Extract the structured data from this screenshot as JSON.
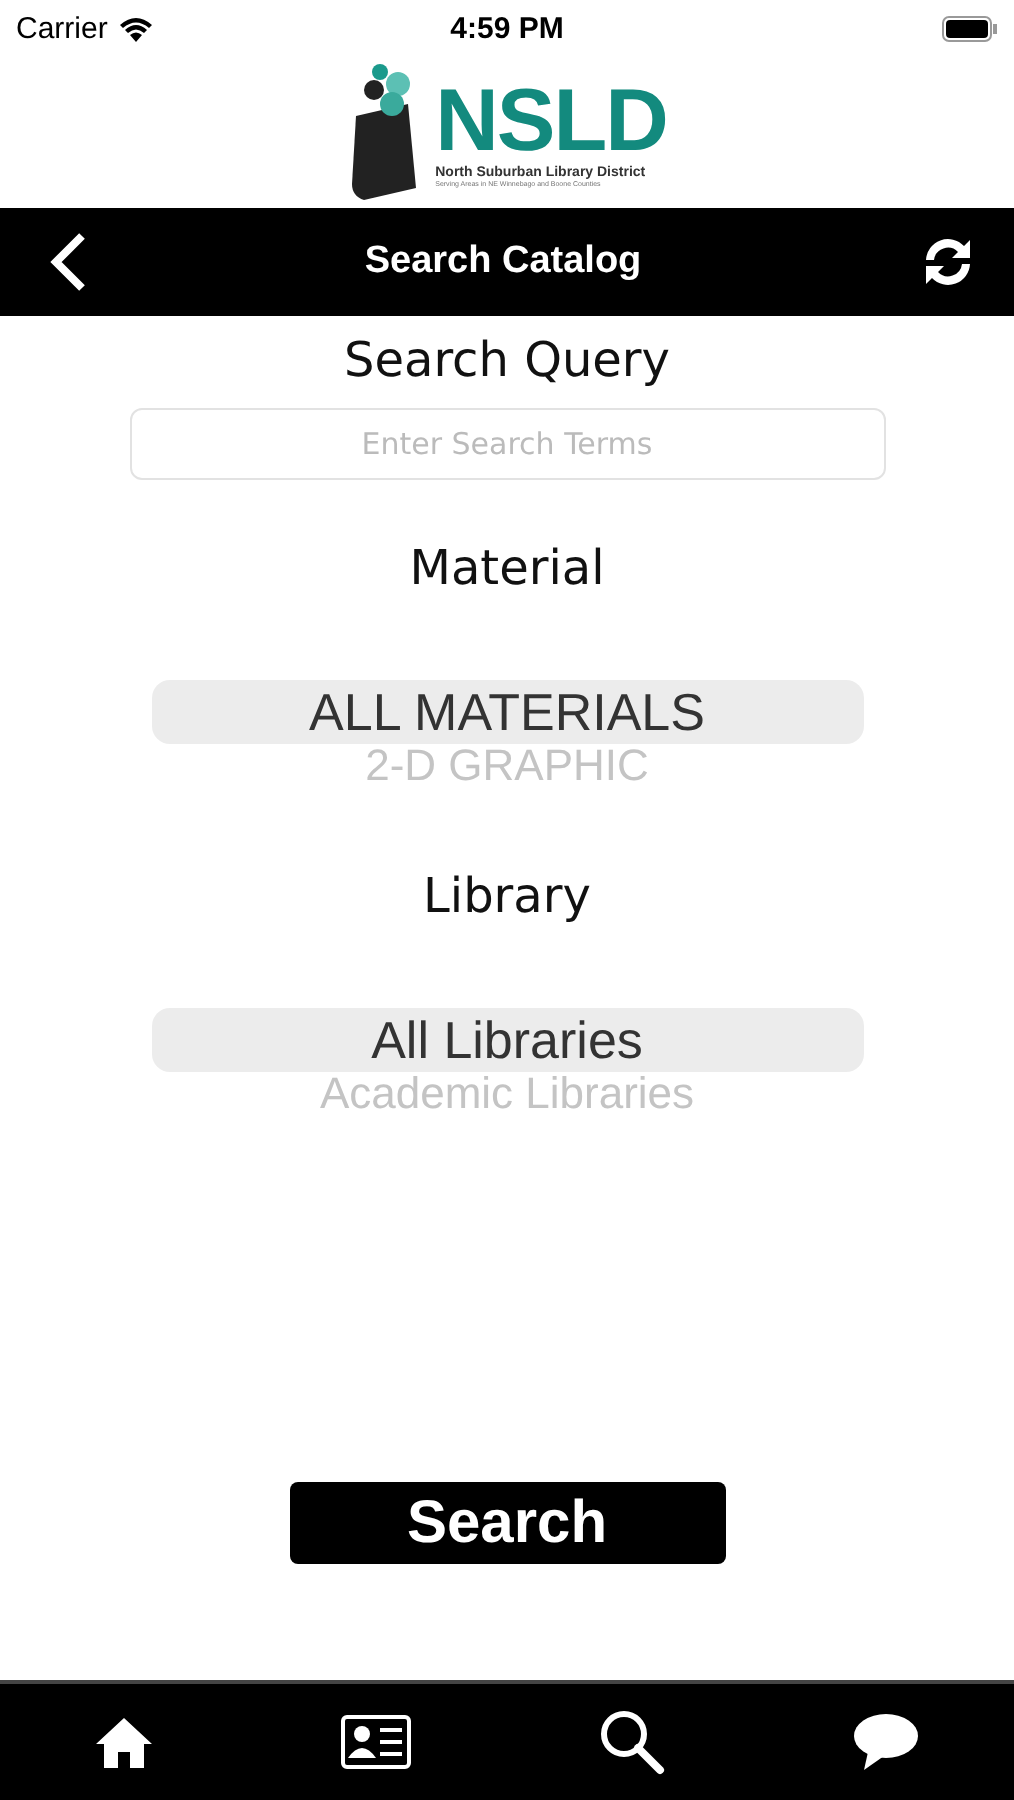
{
  "status_bar": {
    "carrier": "Carrier",
    "time": "4:59 PM"
  },
  "logo": {
    "wordmark": "NSLD",
    "name": "North Suburban Library District",
    "tagline": "Serving Areas in NE Winnebago and Boone Counties"
  },
  "nav_bar": {
    "title": "Search Catalog"
  },
  "search": {
    "label": "Search Query",
    "placeholder": "Enter Search Terms"
  },
  "pickers": [
    {
      "label": "Material",
      "options": [
        {
          "text": "ALL MATERIALS",
          "selected": true
        },
        {
          "text": "2-D GRAPHIC",
          "selected": false
        }
      ]
    },
    {
      "label": "Library",
      "options": [
        {
          "text": "All Libraries",
          "selected": true
        },
        {
          "text": "Academic Libraries",
          "selected": false
        }
      ]
    }
  ],
  "search_button": "Search",
  "tab_bar": [
    {
      "kind": "home"
    },
    {
      "kind": "card"
    },
    {
      "kind": "search"
    },
    {
      "kind": "chat"
    }
  ]
}
